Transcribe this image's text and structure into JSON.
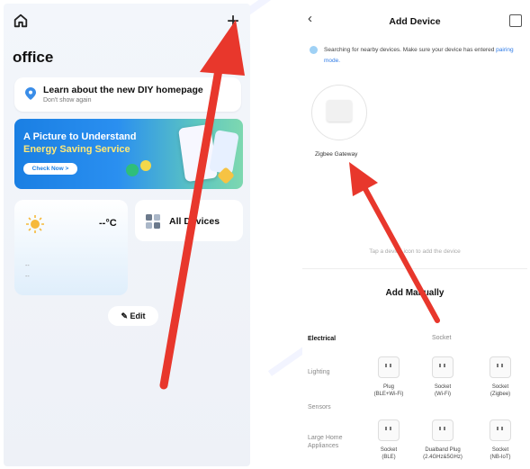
{
  "left": {
    "title": "office",
    "diy_card": {
      "title": "Learn about the new DIY homepage",
      "subtitle": "Don't show again"
    },
    "banner": {
      "line1": "A Picture to Understand",
      "line2": "Energy Saving Service",
      "button": "Check Now >"
    },
    "weather": {
      "temp": "--°C",
      "line1": "--",
      "line2": "--"
    },
    "all_devices": "All Devices",
    "edit": "Edit",
    "icons": {
      "home": "home-icon",
      "add": "plus-icon"
    }
  },
  "right": {
    "title": "Add Device",
    "back": "‹",
    "search_text": "Searching for nearby devices. Make sure your device has entered",
    "search_link": "pairing mode.",
    "gateway_label": "Zigbee Gateway",
    "tap_hint": "Tap a device icon to add the device",
    "manual_title": "Add Manually",
    "socket_header": "Socket",
    "categories": [
      "Electrical",
      "Lighting",
      "Sensors",
      "Large Home Appliances"
    ],
    "devices_row1": [
      {
        "name": "Plug",
        "sub": "(BLE+Wi-Fi)"
      },
      {
        "name": "Socket",
        "sub": "(Wi-Fi)"
      },
      {
        "name": "Socket",
        "sub": "(Zigbee)"
      }
    ],
    "devices_row2": [
      {
        "name": "Socket",
        "sub": "(BLE)"
      },
      {
        "name": "Dualband Plug",
        "sub": "(2.4GHz&5GHz)"
      },
      {
        "name": "Socket",
        "sub": "(NB-IoT)"
      }
    ]
  },
  "colors": {
    "accent": "#2f7be6",
    "arrow": "#e8372c",
    "banner_start": "#1a7fe3"
  }
}
